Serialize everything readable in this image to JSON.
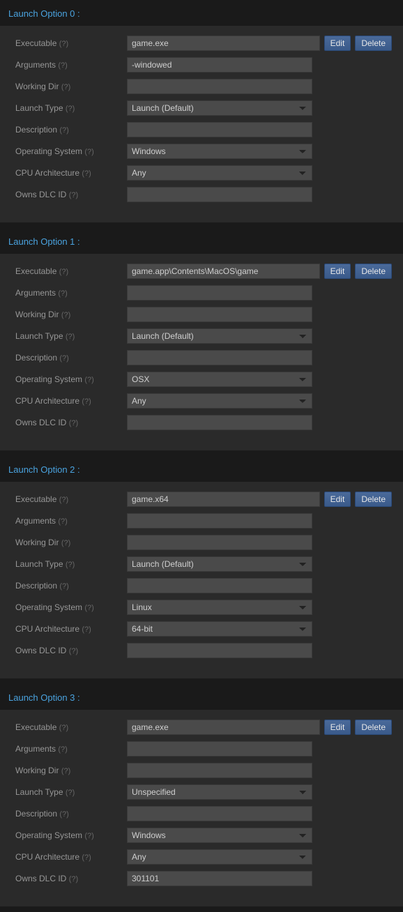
{
  "labels": {
    "executable": "Executable",
    "arguments": "Arguments",
    "working_dir": "Working Dir",
    "launch_type": "Launch Type",
    "description": "Description",
    "operating_system": "Operating System",
    "cpu_architecture": "CPU Architecture",
    "owns_dlc_id": "Owns DLC ID",
    "help": "(?)"
  },
  "buttons": {
    "edit": "Edit",
    "delete": "Delete"
  },
  "options": [
    {
      "title": "Launch Option 0 :",
      "executable": "game.exe",
      "arguments": "-windowed",
      "working_dir": "",
      "launch_type": "Launch (Default)",
      "description": "",
      "operating_system": "Windows",
      "cpu_architecture": "Any",
      "owns_dlc_id": ""
    },
    {
      "title": "Launch Option 1 :",
      "executable": "game.app\\Contents\\MacOS\\game",
      "arguments": "",
      "working_dir": "",
      "launch_type": "Launch (Default)",
      "description": "",
      "operating_system": "OSX",
      "cpu_architecture": "Any",
      "owns_dlc_id": ""
    },
    {
      "title": "Launch Option 2 :",
      "executable": "game.x64",
      "arguments": "",
      "working_dir": "",
      "launch_type": "Launch (Default)",
      "description": "",
      "operating_system": "Linux",
      "cpu_architecture": "64-bit",
      "owns_dlc_id": ""
    },
    {
      "title": "Launch Option 3 :",
      "executable": "game.exe",
      "arguments": "",
      "working_dir": "",
      "launch_type": "Unspecified",
      "description": "",
      "operating_system": "Windows",
      "cpu_architecture": "Any",
      "owns_dlc_id": "301101"
    }
  ]
}
